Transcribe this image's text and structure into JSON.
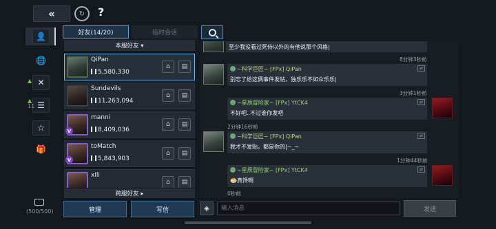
{
  "topbar": {
    "back_icon": "double-chevron-left",
    "refresh_icon": "refresh",
    "help_label": "?"
  },
  "rail": {
    "items": [
      "person-icon",
      "globe-icon",
      "crossed-swords-icon",
      "list-icon",
      "star-icon",
      "gift-icon"
    ],
    "alliance_count": "11",
    "mail_count": "(500/500)"
  },
  "tabs": {
    "friends": "好友(14/20)",
    "temp_chat": "临时会话"
  },
  "list": {
    "group_header": "本服好友 ▾",
    "friends": [
      {
        "name": "QiPan",
        "power": "5,580,330"
      },
      {
        "name": "Sundevils",
        "power": "11,263,094"
      },
      {
        "name": "manni",
        "power": "8,409,036"
      },
      {
        "name": "toMatch",
        "power": "5,843,903"
      },
      {
        "name": "xili",
        "power": ""
      }
    ],
    "cross_server": "跨服好友 ▸",
    "manage": "管理",
    "write_mail": "写信"
  },
  "chat": {
    "messages": [
      {
        "text": "至少我没看过死侍以外的有他说那个风格|",
        "time": "8分钟3秒前"
      },
      {
        "sender": "~科学巨匠~ [FPx] QiPan",
        "text": "别忘了给这俩事件发帖，独乐乐不如众乐乐|",
        "time": "3分钟1秒前"
      },
      {
        "sender": "~星辰冒险家~ [FPx] YtCK4",
        "text": "不好吧..不过谁你发吧",
        "time": "2分钟16秒前"
      },
      {
        "sender": "~科学巨匠~ [FPx] QiPan",
        "text": "我才不发贴，都是你的|~_~",
        "time": "1分钟44秒前"
      },
      {
        "sender": "~星辰冒险家~ [FPx] YtCK4",
        "text": "🍮真馋啊",
        "time": "0秒前"
      }
    ],
    "input_placeholder": "输入消息",
    "send": "发送"
  },
  "colors": {
    "accent": "#5fa3d8",
    "bubble": "#283039",
    "name_gold": "#c8d089",
    "name_green": "#9fd07b"
  }
}
